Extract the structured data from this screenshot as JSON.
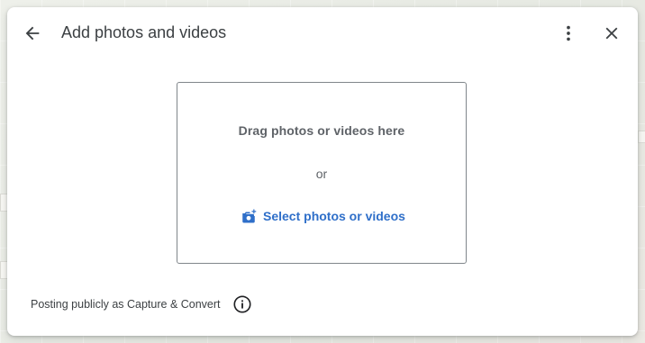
{
  "dialog": {
    "title": "Add photos and videos",
    "icons": {
      "back": "arrow-back-icon",
      "more": "more-vert-icon",
      "close": "close-icon"
    }
  },
  "dropzone": {
    "drag_text": "Drag photos or videos here",
    "or_text": "or",
    "select_label": "Select photos or videos",
    "select_icon": "add-photo-icon"
  },
  "footer": {
    "posting_text": "Posting publicly as Capture & Convert",
    "info_icon": "info-icon"
  },
  "colors": {
    "accent": "#1a73e8",
    "text_primary": "#3c4043",
    "text_secondary": "#5f6368",
    "border": "#80868b"
  }
}
